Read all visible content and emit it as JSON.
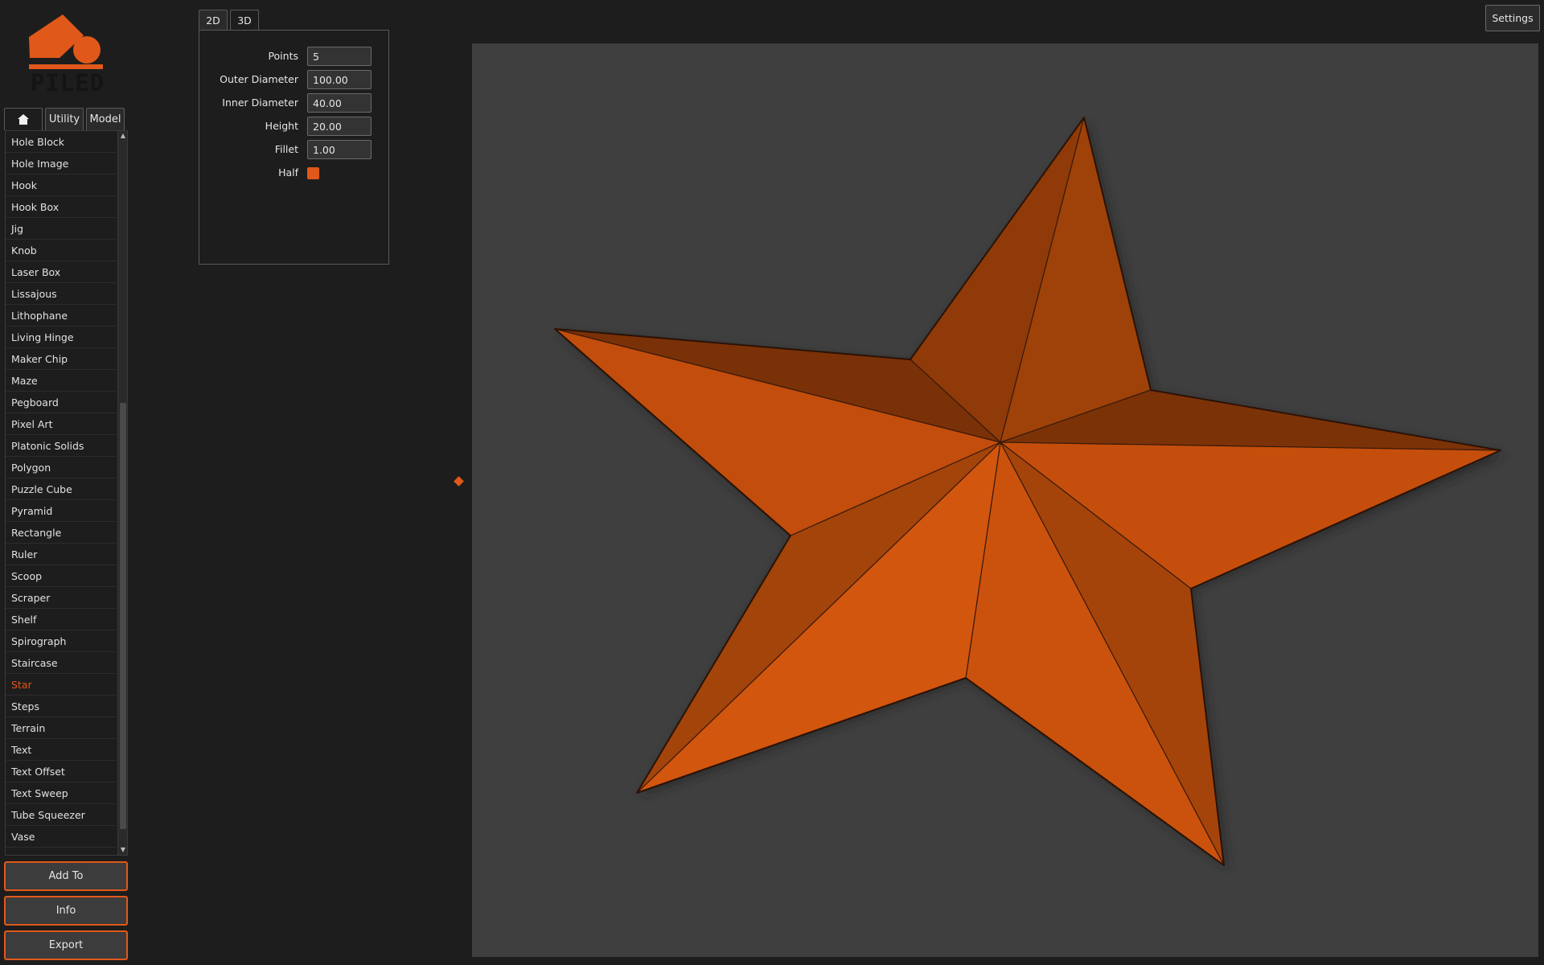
{
  "brand": {
    "name": "PILED",
    "accent": "#e0581a"
  },
  "left_tabs": [
    {
      "icon": "home-icon",
      "label": ""
    },
    {
      "label": "Utility"
    },
    {
      "label": "Model"
    }
  ],
  "models": [
    "Hole Block",
    "Hole Image",
    "Hook",
    "Hook Box",
    "Jig",
    "Knob",
    "Laser Box",
    "Lissajous",
    "Lithophane",
    "Living Hinge",
    "Maker Chip",
    "Maze",
    "Pegboard",
    "Pixel Art",
    "Platonic Solids",
    "Polygon",
    "Puzzle Cube",
    "Pyramid",
    "Rectangle",
    "Ruler",
    "Scoop",
    "Scraper",
    "Shelf",
    "Spirograph",
    "Staircase",
    "Star",
    "Steps",
    "Terrain",
    "Text",
    "Text Offset",
    "Text Sweep",
    "Tube Squeezer",
    "Vase"
  ],
  "selected_model": "Star",
  "actions": {
    "add_to": "Add To",
    "info": "Info",
    "export": "Export"
  },
  "view_tabs": [
    "2D",
    "3D"
  ],
  "params": {
    "points": {
      "label": "Points",
      "value": "5"
    },
    "outer_diameter": {
      "label": "Outer Diameter",
      "value": "100.00"
    },
    "inner_diameter": {
      "label": "Inner Diameter",
      "value": "40.00"
    },
    "height": {
      "label": "Height",
      "value": "20.00"
    },
    "fillet": {
      "label": "Fillet",
      "value": "1.00"
    },
    "half": {
      "label": "Half",
      "checked": true
    }
  },
  "settings_label": "Settings"
}
